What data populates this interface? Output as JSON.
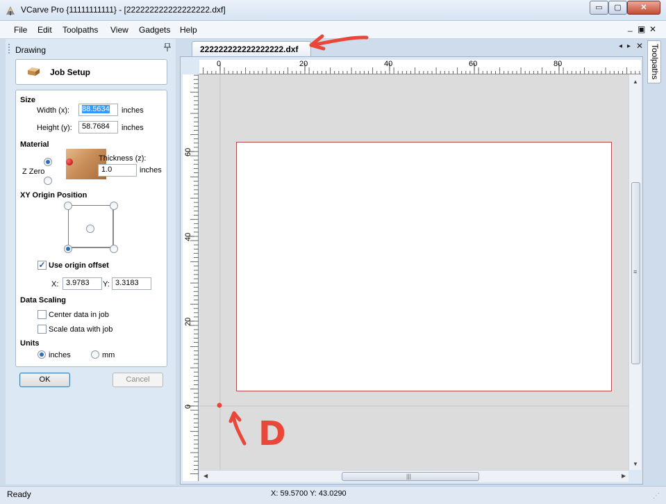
{
  "window": {
    "title": "VCarve Pro {11111111111} - [222222222222222222.dxf]",
    "minimize_glyph": "▭",
    "maximize_glyph": "▢",
    "close_glyph": "✕"
  },
  "menu": {
    "items": [
      "File",
      "Edit",
      "Toolpaths",
      "View",
      "Gadgets",
      "Help"
    ],
    "mdi_minimize": "_",
    "mdi_restore": "▣",
    "mdi_close": "✕"
  },
  "panel": {
    "title": "Drawing",
    "pin_glyph": "📌",
    "job_setup": {
      "title": "Job Setup"
    },
    "size": {
      "heading": "Size",
      "width_label": "Width (x):",
      "width_value": "88.5634",
      "width_unit": "inches",
      "height_label": "Height (y):",
      "height_value": "58.7684",
      "height_unit": "inches"
    },
    "material": {
      "heading": "Material",
      "zzero_label": "Z Zero",
      "thickness_label": "Thickness (z):",
      "thickness_value": "1.0",
      "thickness_unit": "inches",
      "zzero_selected": "top"
    },
    "xy_origin": {
      "heading": "XY Origin Position",
      "selected": "bottom-left",
      "use_offset_label": "Use origin offset",
      "use_offset_checked": true,
      "x_label": "X:",
      "x_value": "3.9783",
      "y_label": "Y:",
      "y_value": "3.3183"
    },
    "data_scaling": {
      "heading": "Data Scaling",
      "center_label": "Center data in job",
      "center_checked": false,
      "scale_label": "Scale data with job",
      "scale_checked": false
    },
    "units": {
      "heading": "Units",
      "inches_label": "inches",
      "mm_label": "mm",
      "selected": "inches"
    },
    "ok_label": "OK",
    "cancel_label": "Cancel"
  },
  "document": {
    "tab_label": "222222222222222222.dxf",
    "tab_prev_glyph": "◂",
    "tab_next_glyph": "▸",
    "tab_close_glyph": "✕",
    "ruler_top_labels": [
      "0",
      "20",
      "40",
      "60",
      "80"
    ],
    "ruler_left_labels": [
      "60",
      "40",
      "20",
      "0"
    ],
    "hscroll_grip": "|||",
    "vscroll_grip": "≡",
    "scroll_up": "▲",
    "scroll_down": "▼",
    "scroll_left": "◀",
    "scroll_right": "▶"
  },
  "side_tabs": {
    "toolpaths": "Toolpaths"
  },
  "status": {
    "text": "Ready",
    "coords": "X: 59.5700 Y: 43.0290"
  },
  "annotations": {
    "letter": "D"
  },
  "colors": {
    "job_border": "#b04a4a",
    "annotation_red": "#e8473a",
    "selection_blue": "#3399ff"
  }
}
